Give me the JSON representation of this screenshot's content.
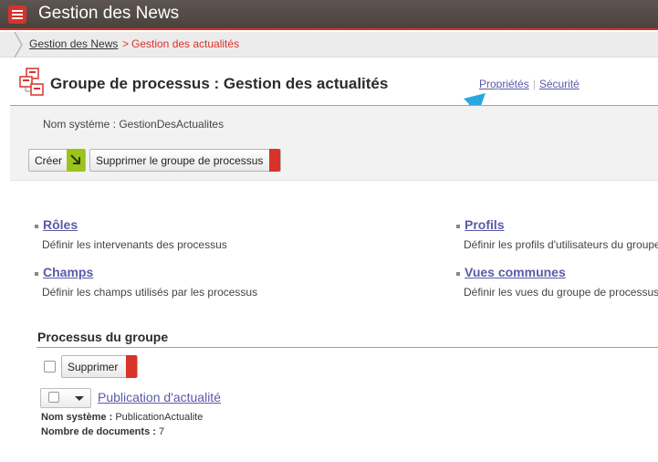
{
  "app": {
    "title": "Gestion des News"
  },
  "breadcrumb": {
    "home": "Gestion des News",
    "separator": ">",
    "current": "Gestion des actualités"
  },
  "header": {
    "title": "Groupe de processus : Gestion des actualités",
    "links": {
      "properties": "Propriétés",
      "separator": "|",
      "security": "Sécurité"
    }
  },
  "info": {
    "system_name": "Nom système : GestionDesActualites",
    "create_label": "Créer",
    "delete_group_label": "Supprimer le groupe de processus"
  },
  "sections": {
    "roles": {
      "title": "Rôles",
      "desc": "Définir les intervenants des processus"
    },
    "profils": {
      "title": "Profils",
      "desc": "Définir les profils d'utilisateurs du groupe"
    },
    "champs": {
      "title": "Champs",
      "desc": "Définir les champs utilisés par les processus"
    },
    "vues": {
      "title": "Vues communes",
      "desc": "Définir les vues du groupe de processus"
    }
  },
  "group": {
    "heading": "Processus du groupe",
    "delete_label": "Supprimer",
    "process": {
      "name": "Publication d'actualité",
      "sysname_label": "Nom système :",
      "sysname_value": "PublicationActualite",
      "count_label": "Nombre de documents :",
      "count_value": "7"
    }
  },
  "colors": {
    "accent": "#d9322a",
    "link": "#5a5aa8",
    "go": "#9ac31c",
    "arrow": "#29a8e0"
  }
}
